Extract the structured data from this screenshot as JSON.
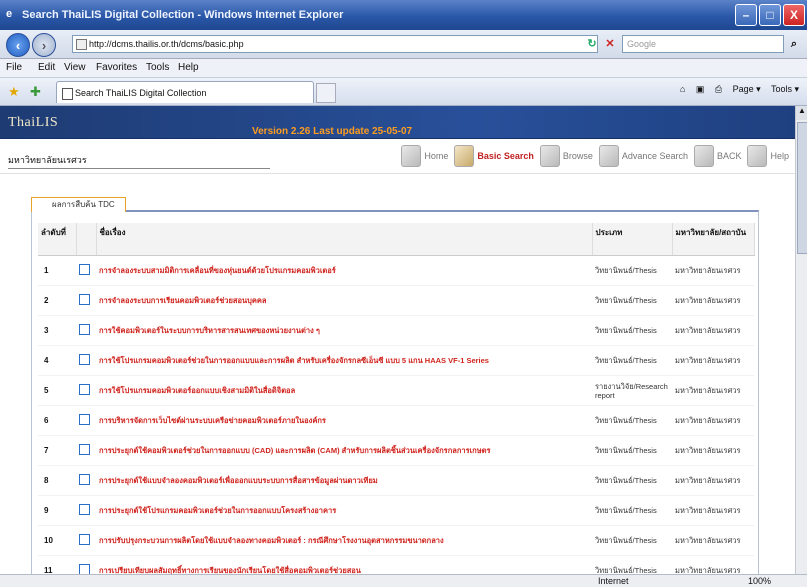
{
  "window": {
    "title": "Search ThaiLIS Digital Collection - Windows Internet Explorer",
    "minimize_glyph": "–",
    "maximize_glyph": "□",
    "close_glyph": "X"
  },
  "address": {
    "url": "http://dcms.thailis.or.th/dcms/basic.php",
    "search_placeholder": "Google",
    "refresh_glyph": "↻",
    "stop_glyph": "✕",
    "search_glyph": "⌕"
  },
  "menu": [
    "File",
    "Edit",
    "View",
    "Favorites",
    "Tools",
    "Help"
  ],
  "tabs": {
    "active_label": "Search ThaiLIS Digital Collection",
    "page_label": "Page ▾",
    "tools_label": "Tools ▾"
  },
  "page": {
    "brand": "ThaiLIS",
    "version": "Version 2.26 Last update 25-05-07",
    "library": "มหาวิทยาลัยนเรศวร",
    "nav": {
      "home": "Home",
      "basic": "Basic Search",
      "browse": "Browse",
      "advance": "Advance Search",
      "back": "BACK",
      "help": "Help"
    },
    "results_tab": "ผลการสืบค้น TDC"
  },
  "table": {
    "headers": {
      "no": "ลำดับที่",
      "title": "ชื่อเรื่อง",
      "type": "ประเภท",
      "lib": "มหาวิทยาลัย/สถาบัน"
    },
    "rows": [
      {
        "no": "1",
        "title": "การจำลองระบบสามมิติการเคลื่อนที่ของหุ่นยนต์ด้วยโปรแกรมคอมพิวเตอร์",
        "type": "วิทยานิพนธ์/Thesis",
        "lib": "มหาวิทยาลัยนเรศวร"
      },
      {
        "no": "2",
        "title": "การจำลองระบบการเรียนคอมพิวเตอร์ช่วยสอนบุคคล",
        "type": "วิทยานิพนธ์/Thesis",
        "lib": "มหาวิทยาลัยนเรศวร"
      },
      {
        "no": "3",
        "title": "การใช้คอมพิวเตอร์ในระบบการบริหารสารสนเทศของหน่วยงานต่าง ๆ",
        "type": "วิทยานิพนธ์/Thesis",
        "lib": "มหาวิทยาลัยนเรศวร"
      },
      {
        "no": "4",
        "title": "การใช้โปรแกรมคอมพิวเตอร์ช่วยในการออกแบบและการผลิต สำหรับเครื่องจักรกลซีเอ็นซี แบบ 5 แกน HAAS VF-1 Series",
        "type": "วิทยานิพนธ์/Thesis",
        "lib": "มหาวิทยาลัยนเรศวร"
      },
      {
        "no": "5",
        "title": "การใช้โปรแกรมคอมพิวเตอร์ออกแบบเชิงสามมิติในสื่อดิจิตอล",
        "type": "รายงานวิจัย/Research report",
        "lib": "มหาวิทยาลัยนเรศวร"
      },
      {
        "no": "6",
        "title": "การบริหารจัดการเว็บไซต์ผ่านระบบเครือข่ายคอมพิวเตอร์ภายในองค์กร",
        "type": "วิทยานิพนธ์/Thesis",
        "lib": "มหาวิทยาลัยนเรศวร"
      },
      {
        "no": "7",
        "title": "การประยุกต์ใช้คอมพิวเตอร์ช่วยในการออกแบบ (CAD) และการผลิต (CAM) สำหรับการผลิตชิ้นส่วนเครื่องจักรกลการเกษตร",
        "type": "วิทยานิพนธ์/Thesis",
        "lib": "มหาวิทยาลัยนเรศวร"
      },
      {
        "no": "8",
        "title": "การประยุกต์ใช้แบบจำลองคอมพิวเตอร์เพื่อออกแบบระบบการสื่อสารข้อมูลผ่านดาวเทียม",
        "type": "วิทยานิพนธ์/Thesis",
        "lib": "มหาวิทยาลัยนเรศวร"
      },
      {
        "no": "9",
        "title": "การประยุกต์ใช้โปรแกรมคอมพิวเตอร์ช่วยในการออกแบบโครงสร้างอาคาร",
        "type": "วิทยานิพนธ์/Thesis",
        "lib": "มหาวิทยาลัยนเรศวร"
      },
      {
        "no": "10",
        "title": "การปรับปรุงกระบวนการผลิตโดยใช้แบบจำลองทางคอมพิวเตอร์ : กรณีศึกษาโรงงานอุตสาหกรรมขนาดกลาง",
        "type": "วิทยานิพนธ์/Thesis",
        "lib": "มหาวิทยาลัยนเรศวร"
      },
      {
        "no": "11",
        "title": "การเปรียบเทียบผลสัมฤทธิ์ทางการเรียนของนักเรียนโดยใช้สื่อคอมพิวเตอร์ช่วยสอน",
        "type": "วิทยานิพนธ์/Thesis",
        "lib": "มหาวิทยาลัยนเรศวร"
      }
    ]
  },
  "status": {
    "zone": "Internet",
    "zoom": "100%"
  },
  "colors": {
    "banner": "#28509a",
    "version": "#ff9d1f",
    "title_link": "#d0241e",
    "active_nav": "#c02222"
  }
}
